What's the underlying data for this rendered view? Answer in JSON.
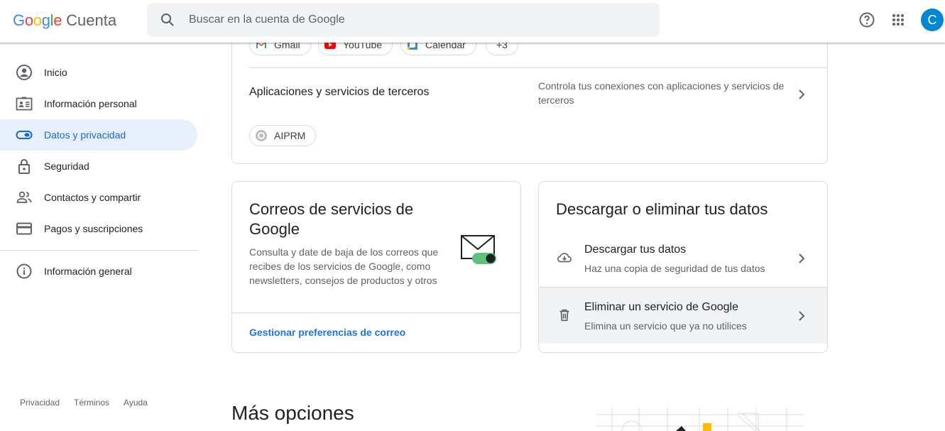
{
  "header": {
    "logo_google": "Google",
    "logo_product": "Cuenta",
    "search_placeholder": "Buscar en la cuenta de Google",
    "avatar_letter": "C",
    "colors": {
      "blue": "#4285F4",
      "red": "#EA4335",
      "yellow": "#FBBC05",
      "green": "#34A853",
      "avatar": "#0288d1"
    }
  },
  "sidebar": {
    "items": [
      {
        "label": "Inicio",
        "icon": "account-circle-icon"
      },
      {
        "label": "Información personal",
        "icon": "id-card-icon"
      },
      {
        "label": "Datos y privacidad",
        "icon": "toggle-icon",
        "active": true
      },
      {
        "label": "Seguridad",
        "icon": "lock-icon"
      },
      {
        "label": "Contactos y compartir",
        "icon": "people-icon"
      },
      {
        "label": "Pagos y suscripciones",
        "icon": "credit-card-icon"
      }
    ],
    "info_item": {
      "label": "Información general",
      "icon": "info-icon"
    },
    "footer": {
      "privacy": "Privacidad",
      "terms": "Términos",
      "help": "Ayuda"
    }
  },
  "top_card": {
    "app_chips": [
      "Gmail",
      "YouTube",
      "Calendar",
      "+3"
    ],
    "third_party": {
      "title": "Aplicaciones y servicios de terceros",
      "description": "Controla tus conexiones con aplicaciones y servicios de terceros",
      "chip": "AIPRM"
    }
  },
  "mail_card": {
    "title": "Correos de servicios de Google",
    "description": "Consulta y date de baja de los correos que recibes de los servicios de Google, como newsletters, consejos de productos y otros",
    "link": "Gestionar preferencias de correo"
  },
  "download_card": {
    "title": "Descargar o eliminar tus datos",
    "items": [
      {
        "title": "Descargar tus datos",
        "subtitle": "Haz una copia de seguridad de tus datos",
        "icon": "cloud-download-icon"
      },
      {
        "title": "Eliminar un servicio de Google",
        "subtitle": "Elimina un servicio que ya no utilices",
        "icon": "trash-icon"
      }
    ]
  },
  "more_options": {
    "title": "Más opciones"
  }
}
